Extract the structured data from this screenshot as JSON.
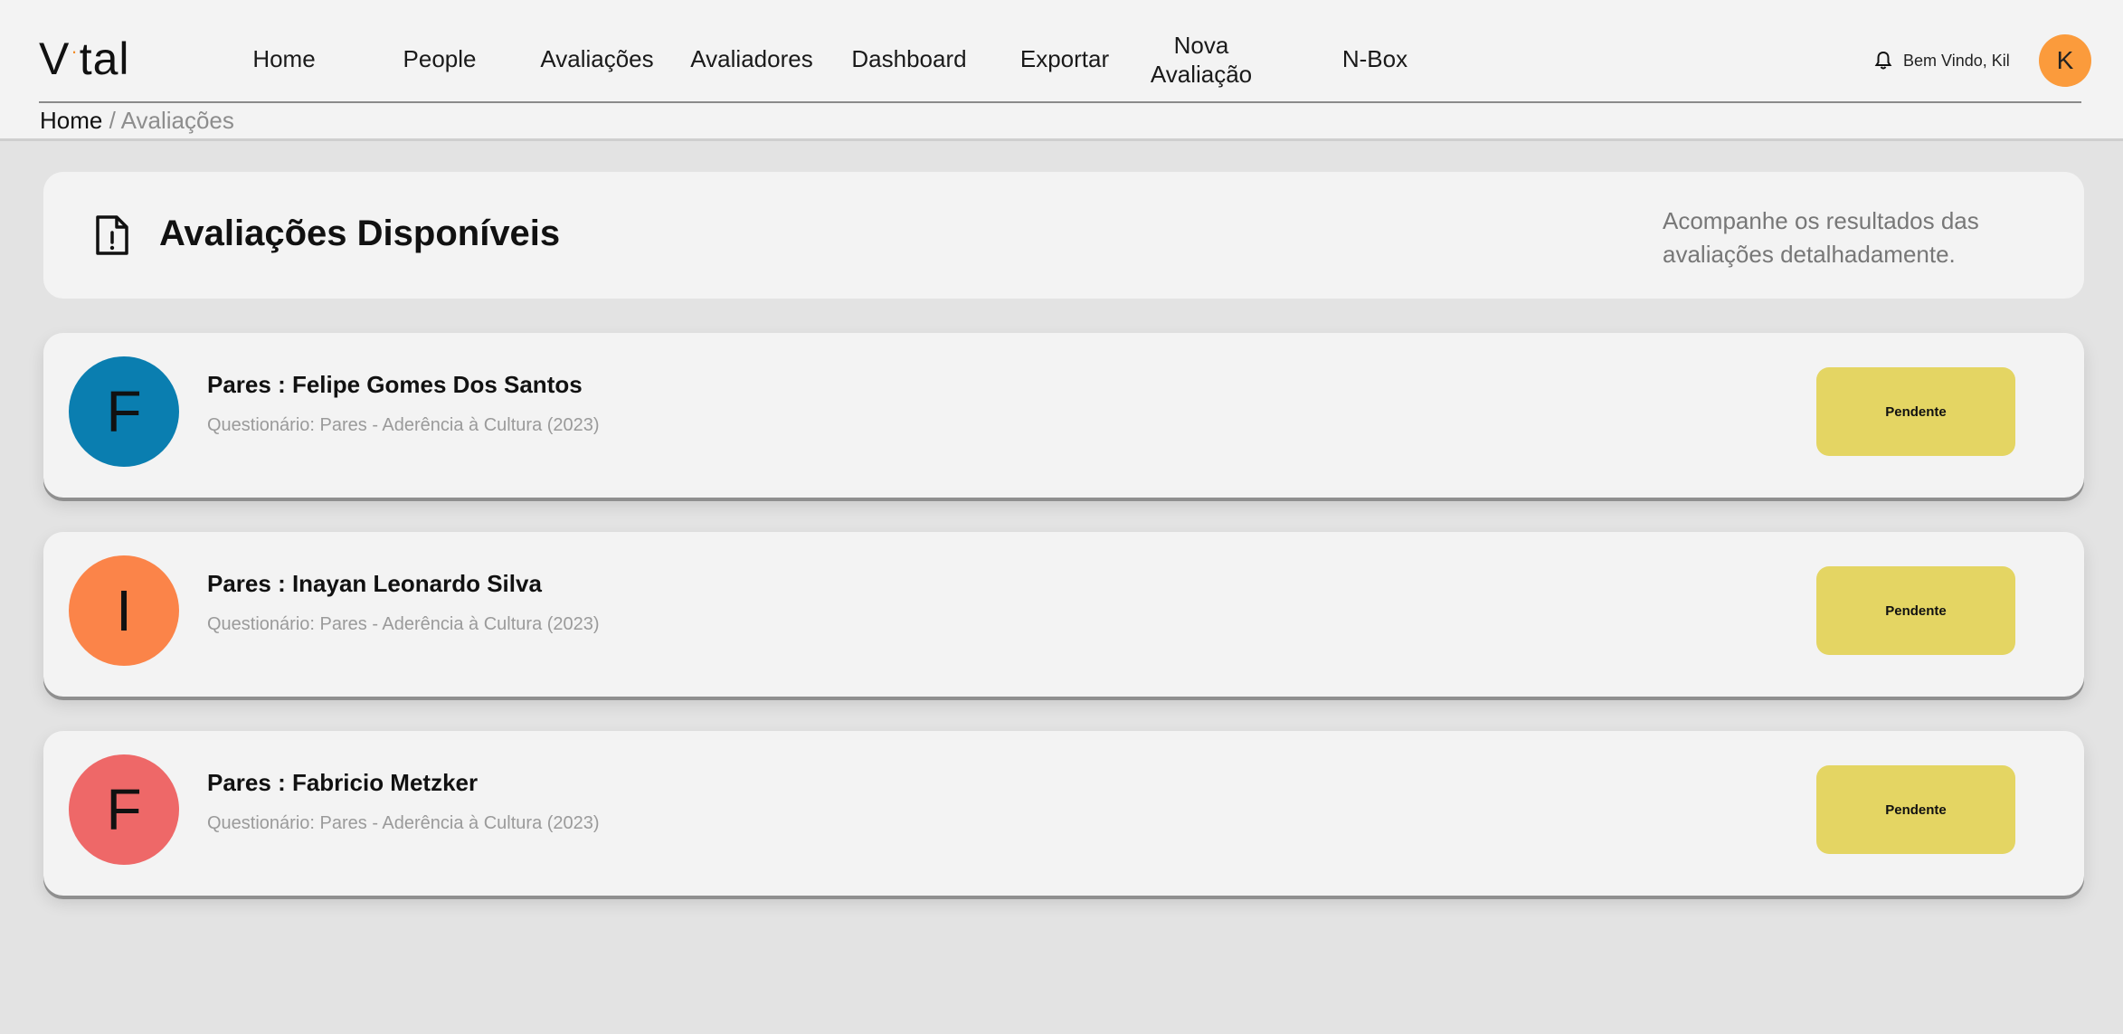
{
  "logo": {
    "left": "V",
    "dot": "·",
    "right": "tal"
  },
  "nav": {
    "items": [
      {
        "label": "Home",
        "name": "nav-home"
      },
      {
        "label": "People",
        "name": "nav-people"
      },
      {
        "label": "Avaliações",
        "name": "nav-avaliacoes"
      },
      {
        "label": "Avaliadores",
        "name": "nav-avaliadores"
      },
      {
        "label": "Dashboard",
        "name": "nav-dashboard"
      },
      {
        "label": "Exportar",
        "name": "nav-exportar"
      },
      {
        "label": "Nova Avaliação",
        "name": "nav-nova-avaliacao"
      },
      {
        "label": "N-Box",
        "name": "nav-n-box"
      }
    ]
  },
  "user": {
    "welcome": "Bem Vindo, Kil",
    "initial": "K",
    "avatar_color": "#fb9b3c"
  },
  "breadcrumb": {
    "home": "Home",
    "separator": " / ",
    "current": "Avaliações"
  },
  "page": {
    "title": "Avaliações Disponíveis",
    "subtitle": "Acompanhe os resultados das avaliações detalhadamente."
  },
  "evaluations": [
    {
      "initial": "F",
      "title": "Pares : Felipe Gomes Dos Santos",
      "questionnaire": "Questionário: Pares - Aderência à Cultura (2023)",
      "status": "Pendente",
      "avatar_color": "#0a7eb0"
    },
    {
      "initial": "I",
      "title": "Pares : Inayan Leonardo Silva",
      "questionnaire": "Questionário: Pares - Aderência à Cultura (2023)",
      "status": "Pendente",
      "avatar_color": "#fb8449"
    },
    {
      "initial": "F",
      "title": "Pares : Fabricio Metzker",
      "questionnaire": "Questionário: Pares - Aderência à Cultura (2023)",
      "status": "Pendente",
      "avatar_color": "#ee6868"
    }
  ],
  "colors": {
    "status_pending": "#e4d563",
    "background": "#e3e3e3",
    "card": "#f3f3f3"
  }
}
